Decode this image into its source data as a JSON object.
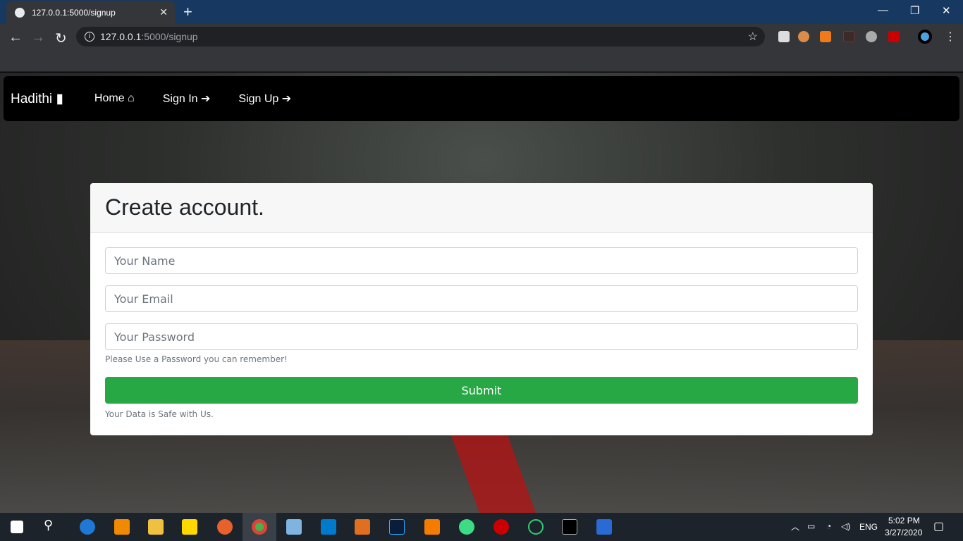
{
  "browser": {
    "tab_title": "127.0.0.1:5000/signup",
    "url_host": "127.0.0.1",
    "url_rest": ":5000/signup"
  },
  "navbar": {
    "brand": "Hadithi",
    "links": [
      {
        "label": "Home"
      },
      {
        "label": "Sign In"
      },
      {
        "label": "Sign Up"
      }
    ]
  },
  "form": {
    "title": "Create account.",
    "name_placeholder": "Your Name",
    "email_placeholder": "Your Email",
    "password_placeholder": "Your Password",
    "password_help": "Please Use a Password you can remember!",
    "submit_label": "Submit",
    "footer_note": "Your Data is Safe with Us."
  },
  "taskbar": {
    "lang": "ENG",
    "time": "5:02 PM",
    "date": "3/27/2020"
  },
  "colors": {
    "submit": "#28a745",
    "titlebar": "#163861"
  }
}
